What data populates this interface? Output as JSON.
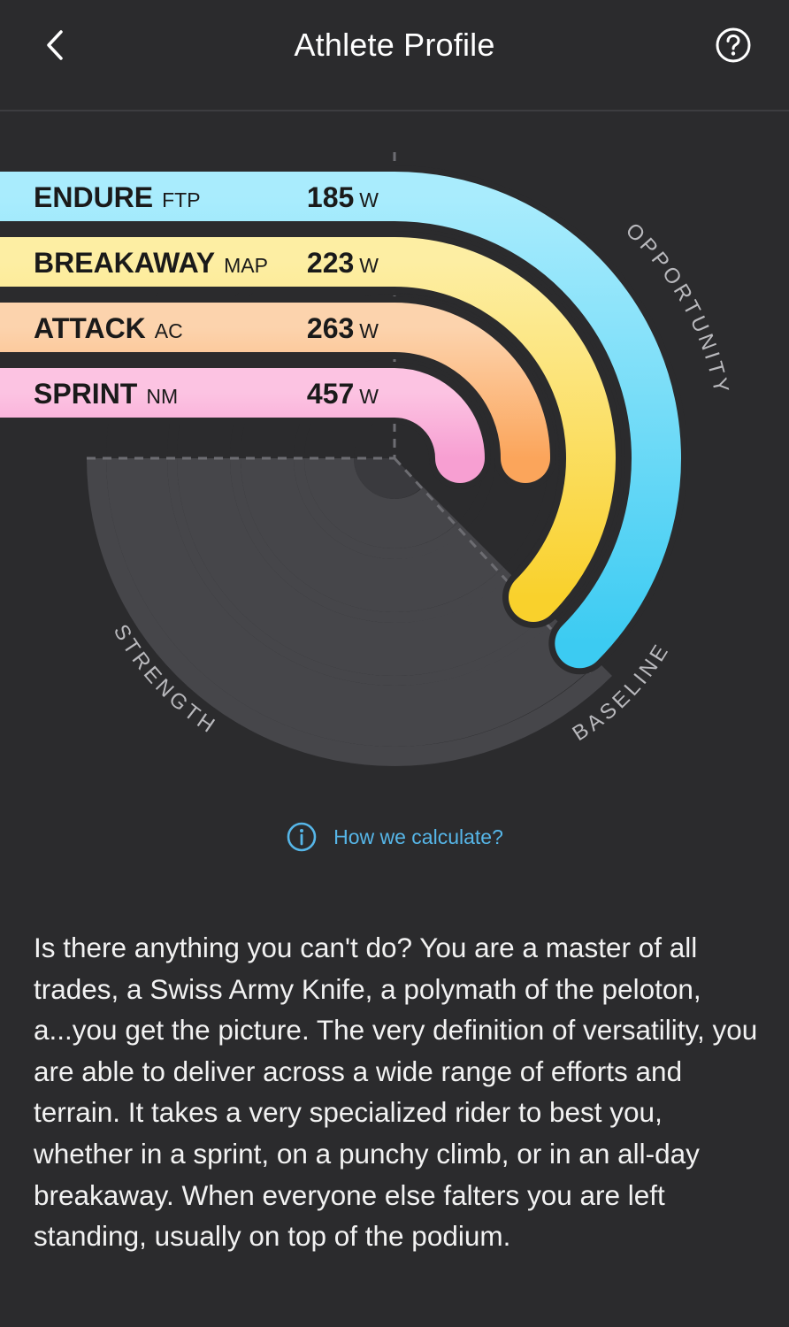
{
  "header": {
    "title": "Athlete Profile",
    "back_icon": "chevron-left-icon",
    "help_icon": "question-circle-icon"
  },
  "chart_data": {
    "type": "radial-bar",
    "metrics": [
      {
        "name": "ENDURE",
        "abbr": "FTP",
        "value": 185,
        "unit": "W",
        "color_start": "#a9ecfd",
        "color_end": "#3ccbf2",
        "sweep_deg": 135
      },
      {
        "name": "BREAKAWAY",
        "abbr": "MAP",
        "value": 223,
        "unit": "W",
        "color_start": "#fdeea3",
        "color_end": "#f9d12c",
        "sweep_deg": 135
      },
      {
        "name": "ATTACK",
        "abbr": "AC",
        "value": 263,
        "unit": "W",
        "color_start": "#fcd3ad",
        "color_end": "#fba55b",
        "sweep_deg": 90
      },
      {
        "name": "SPRINT",
        "abbr": "NM",
        "value": 457,
        "unit": "W",
        "color_start": "#fcc3e2",
        "color_end": "#f79fd2",
        "sweep_deg": 90
      }
    ],
    "axis_labels": {
      "opportunity": "OPPORTUNITY",
      "baseline": "BASELINE",
      "strength": "STRENGTH"
    },
    "track_color": "#46464a"
  },
  "calc_link": {
    "label": "How we calculate?",
    "icon": "info-circle-icon",
    "color": "#56b6e8"
  },
  "description": "Is there anything you can't do? You are a master of all trades, a Swiss Army Knife, a polymath of the peloton, a...you get the picture. The very definition of versatility, you are able to deliver across a wide range of efforts and terrain. It takes a very specialized rider to best you, whether in a sprint, on a punchy climb, or in an all-day breakaway. When everyone else falters you are left standing, usually on top of the podium."
}
